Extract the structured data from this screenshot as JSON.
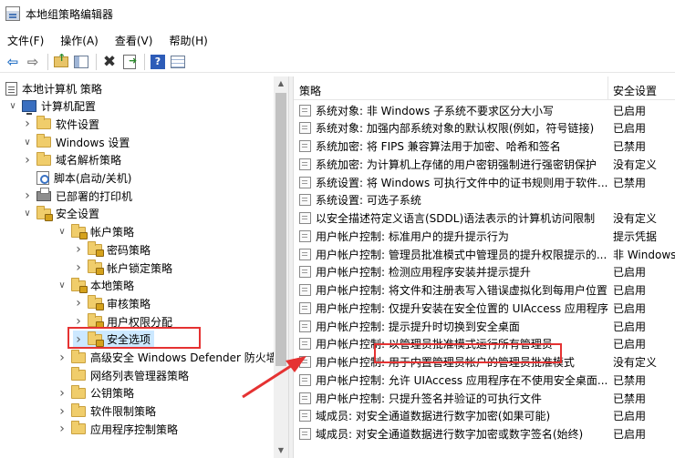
{
  "window": {
    "title": "本地组策略编辑器"
  },
  "menu": [
    {
      "label": "文件(F)"
    },
    {
      "label": "操作(A)"
    },
    {
      "label": "查看(V)"
    },
    {
      "label": "帮助(H)"
    }
  ],
  "toolbar": {
    "icons": [
      "back-arrow-icon",
      "forward-arrow-icon",
      "up-folder-icon",
      "show-hide-tree-icon",
      "delete-icon",
      "export-list-icon",
      "help-icon",
      "properties-icon"
    ]
  },
  "tree": [
    {
      "label": "本地计算机 策略",
      "icon": "document",
      "level": 0,
      "chevron": ""
    },
    {
      "label": "计算机配置",
      "icon": "computer",
      "level": 1,
      "chevron": "down"
    },
    {
      "label": "软件设置",
      "icon": "folder",
      "level": 2,
      "chevron": "right"
    },
    {
      "label": "Windows 设置",
      "icon": "folder",
      "level": 2,
      "chevron": "down"
    },
    {
      "label": "域名解析策略",
      "icon": "folder",
      "level": 3,
      "chevron": "right"
    },
    {
      "label": "脚本(启动/关机)",
      "icon": "script",
      "level": 3,
      "chevron": ""
    },
    {
      "label": "已部署的打印机",
      "icon": "printer",
      "level": 3,
      "chevron": "right"
    },
    {
      "label": "安全设置",
      "icon": "lockfolder",
      "level": 3,
      "chevron": "down"
    },
    {
      "label": "帐户策略",
      "icon": "lockfolder",
      "level": 4,
      "chevron": "down"
    },
    {
      "label": "密码策略",
      "icon": "lockfolder",
      "level": 5,
      "chevron": "right"
    },
    {
      "label": "帐户锁定策略",
      "icon": "lockfolder",
      "level": 5,
      "chevron": "right"
    },
    {
      "label": "本地策略",
      "icon": "lockfolder",
      "level": 4,
      "chevron": "down"
    },
    {
      "label": "审核策略",
      "icon": "lockfolder",
      "level": 5,
      "chevron": "right"
    },
    {
      "label": "用户权限分配",
      "icon": "lockfolder",
      "level": 5,
      "chevron": "right"
    },
    {
      "label": "安全选项",
      "icon": "lockfolder",
      "level": 5,
      "chevron": "right",
      "selected": true
    },
    {
      "label": "高级安全 Windows Defender 防火墙",
      "icon": "folder",
      "level": 4,
      "chevron": "right"
    },
    {
      "label": "网络列表管理器策略",
      "icon": "folder",
      "level": 4,
      "chevron": ""
    },
    {
      "label": "公钥策略",
      "icon": "folder",
      "level": 4,
      "chevron": "right"
    },
    {
      "label": "软件限制策略",
      "icon": "folder",
      "level": 4,
      "chevron": "right"
    },
    {
      "label": "应用程序控制策略",
      "icon": "folder",
      "level": 4,
      "chevron": "right"
    }
  ],
  "list": {
    "col_policy": "策略",
    "col_setting": "安全设置",
    "rows": [
      {
        "policy": "系统对象: 非 Windows 子系统不要求区分大小写",
        "setting": "已启用"
      },
      {
        "policy": "系统对象: 加强内部系统对象的默认权限(例如，符号链接)",
        "setting": "已启用"
      },
      {
        "policy": "系统加密: 将 FIPS 兼容算法用于加密、哈希和签名",
        "setting": "已禁用"
      },
      {
        "policy": "系统加密: 为计算机上存储的用户密钥强制进行强密钥保护",
        "setting": "没有定义"
      },
      {
        "policy": "系统设置: 将 Windows 可执行文件中的证书规则用于软件...",
        "setting": "已禁用"
      },
      {
        "policy": "系统设置: 可选子系统",
        "setting": ""
      },
      {
        "policy": "以安全描述符定义语言(SDDL)语法表示的计算机访问限制",
        "setting": "没有定义"
      },
      {
        "policy": "用户帐户控制: 标准用户的提升提示行为",
        "setting": "提示凭据"
      },
      {
        "policy": "用户帐户控制: 管理员批准模式中管理员的提升权限提示的...",
        "setting": "非 Windows"
      },
      {
        "policy": "用户帐户控制: 检测应用程序安装并提示提升",
        "setting": "已启用"
      },
      {
        "policy": "用户帐户控制: 将文件和注册表写入错误虚拟化到每用户位置",
        "setting": "已启用"
      },
      {
        "policy": "用户帐户控制: 仅提升安装在安全位置的 UIAccess 应用程序",
        "setting": "已启用"
      },
      {
        "policy": "用户帐户控制: 提示提升时切换到安全桌面",
        "setting": "已启用"
      },
      {
        "policy": "用户帐户控制: 以管理员批准模式运行所有管理员",
        "setting": "已启用"
      },
      {
        "policy": "用户帐户控制: 用于内置管理员帐户的管理员批准模式",
        "setting": "没有定义"
      },
      {
        "policy": "用户帐户控制: 允许 UIAccess 应用程序在不使用安全桌面...",
        "setting": "已禁用"
      },
      {
        "policy": "用户帐户控制: 只提升签名并验证的可执行文件",
        "setting": "已禁用"
      },
      {
        "policy": "域成员: 对安全通道数据进行数字加密(如果可能)",
        "setting": "已启用"
      },
      {
        "policy": "域成员: 对安全通道数据进行数字加密或数字签名(始终)",
        "setting": "已启用"
      }
    ]
  },
  "colors": {
    "highlight_red": "#e53232",
    "selected_bg": "#cce8ff"
  }
}
